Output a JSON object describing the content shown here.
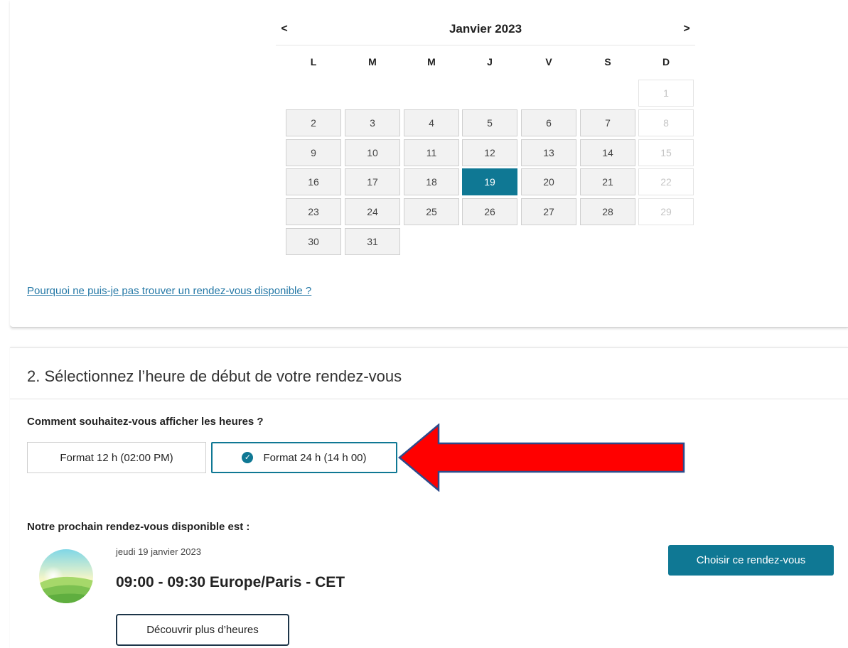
{
  "calendar": {
    "title": "Janvier 2023",
    "prev_label": "<",
    "next_label": ">",
    "weekdays": [
      "L",
      "M",
      "M",
      "J",
      "V",
      "S",
      "D"
    ],
    "weeks": [
      [
        null,
        null,
        null,
        null,
        null,
        null,
        {
          "day": "1",
          "state": "disabled"
        }
      ],
      [
        {
          "day": "2"
        },
        {
          "day": "3"
        },
        {
          "day": "4"
        },
        {
          "day": "5"
        },
        {
          "day": "6"
        },
        {
          "day": "7"
        },
        {
          "day": "8",
          "state": "disabled"
        }
      ],
      [
        {
          "day": "9"
        },
        {
          "day": "10"
        },
        {
          "day": "11"
        },
        {
          "day": "12"
        },
        {
          "day": "13"
        },
        {
          "day": "14"
        },
        {
          "day": "15",
          "state": "disabled"
        }
      ],
      [
        {
          "day": "16"
        },
        {
          "day": "17"
        },
        {
          "day": "18"
        },
        {
          "day": "19",
          "state": "selected"
        },
        {
          "day": "20"
        },
        {
          "day": "21"
        },
        {
          "day": "22",
          "state": "disabled"
        }
      ],
      [
        {
          "day": "23"
        },
        {
          "day": "24"
        },
        {
          "day": "25"
        },
        {
          "day": "26"
        },
        {
          "day": "27"
        },
        {
          "day": "28"
        },
        {
          "day": "29",
          "state": "disabled"
        }
      ],
      [
        {
          "day": "30"
        },
        {
          "day": "31"
        },
        null,
        null,
        null,
        null,
        null
      ]
    ]
  },
  "help_link": "Pourquoi ne puis-je pas trouver un rendez-vous disponible ?",
  "time_section": {
    "title": "2. Sélectionnez l’heure de début de votre rendez-vous",
    "format_question": "Comment souhaitez-vous afficher les heures ?",
    "format_12_label": "Format 12 h (02:00 PM)",
    "format_24_label": "Format 24 h (14 h 00)",
    "selected_format": "24h"
  },
  "next_appointment": {
    "label": "Notre prochain rendez-vous disponible est :",
    "date": "jeudi 19 janvier 2023",
    "time": "09:00 - 09:30 Europe/Paris - CET",
    "choose_label": "Choisir ce rendez-vous",
    "more_label": "Découvrir plus d’heures"
  },
  "colors": {
    "accent": "#0f7894",
    "link": "#2478a6",
    "arrow": "#ff0000",
    "arrow_outline": "#2e4a8a"
  },
  "icons": {
    "check": "check-circle-icon",
    "arrow": "red-arrow-annotation",
    "avatar": "sunrise-landscape-icon"
  }
}
